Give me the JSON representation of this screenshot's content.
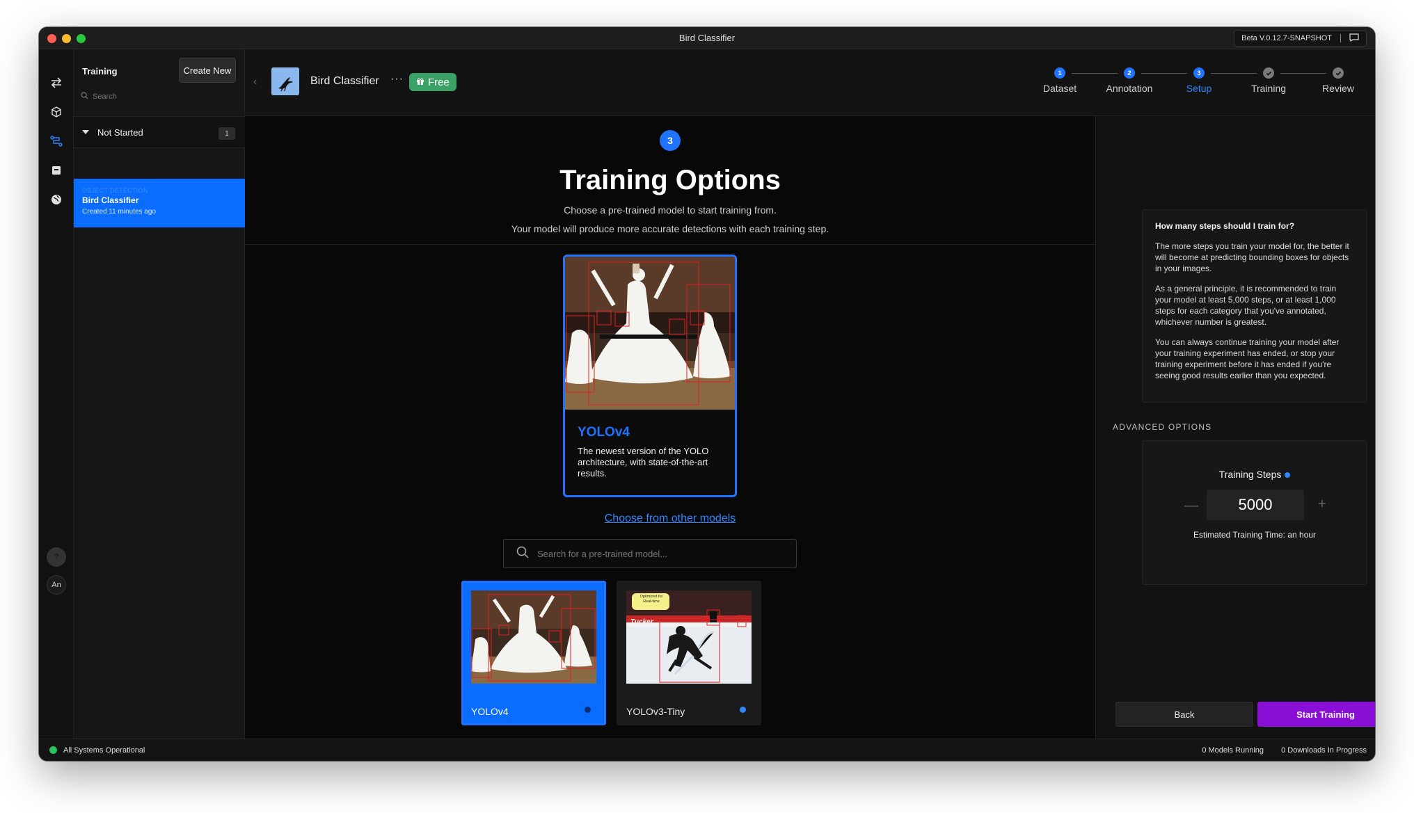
{
  "window": {
    "title": "Bird Classifier",
    "version": "Beta V.0.12.7-SNAPSHOT"
  },
  "rail": {
    "icons": [
      "swap-icon",
      "cube-icon",
      "training-icon",
      "archive-icon",
      "globe-icon"
    ],
    "help": "?",
    "avatar": "An"
  },
  "sidebar": {
    "title": "Training",
    "create_label": "Create New",
    "search_placeholder": "Search",
    "group": {
      "label": "Not Started",
      "count": "1"
    },
    "item": {
      "tag": "OBJECT DETECTION",
      "name": "Bird Classifier",
      "sub": "Created 11 minutes ago"
    }
  },
  "header": {
    "project_name": "Bird Classifier",
    "more": "···",
    "badge": "Free",
    "steps": [
      {
        "num": "1",
        "label": "Dataset",
        "state": "done"
      },
      {
        "num": "2",
        "label": "Annotation",
        "state": "done"
      },
      {
        "num": "3",
        "label": "Setup",
        "state": "active"
      },
      {
        "num": "",
        "label": "Training",
        "state": "todo"
      },
      {
        "num": "",
        "label": "Review",
        "state": "todo"
      }
    ]
  },
  "main": {
    "step_number": "3",
    "title": "Training Options",
    "subtitle1": "Choose a pre-trained model to start training from.",
    "subtitle2": "Your model will produce more accurate detections with each training step.",
    "featured": {
      "name": "YOLOv4",
      "description": "The newest version of the YOLO architecture, with state-of-the-art results."
    },
    "other_models_link": "Choose from other models",
    "search_placeholder": "Search for a pre-trained model...",
    "models": [
      {
        "name": "YOLOv4",
        "selected": true
      },
      {
        "name": "YOLOv3-Tiny",
        "selected": false,
        "tag": "Optimized for Real-time"
      }
    ]
  },
  "right_panel": {
    "help_title": "How many steps should I train for?",
    "help_p1": "The more steps you train your model for, the better it will become at predicting bounding boxes for objects in your images.",
    "help_p2": "As a general principle, it is recommended to train your model at least 5,000 steps, or at least 1,000 steps for each category that you've annotated, whichever number is greatest.",
    "help_p3": "You can always continue training your model after your training experiment has ended, or stop your training experiment before it has ended if you're seeing good results earlier than you expected.",
    "advanced_label": "ADVANCED OPTIONS",
    "steps_label": "Training Steps",
    "steps_value": "5000",
    "estimate": "Estimated Training Time: an hour",
    "back_label": "Back",
    "start_label": "Start Training"
  },
  "status": {
    "left": "All Systems Operational",
    "models_running": "0 Models Running",
    "downloads": "0 Downloads In Progress"
  },
  "colors": {
    "accent": "#1f73ff",
    "start": "#8a0fd6",
    "free": "#3aa266",
    "ok": "#2ac25a"
  }
}
